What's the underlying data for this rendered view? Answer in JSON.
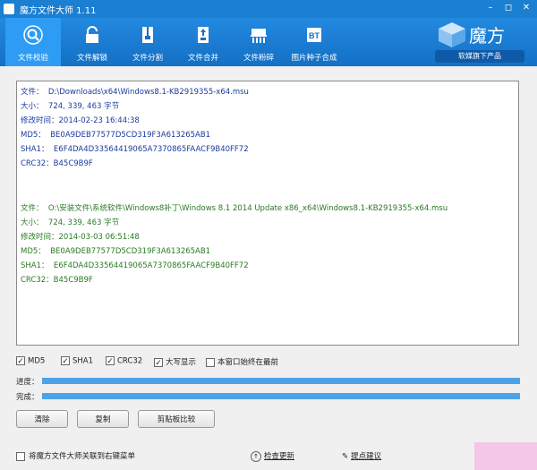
{
  "window": {
    "title": "魔方文件大师 1.11"
  },
  "toolbar": {
    "tools": [
      {
        "label": "文件校验"
      },
      {
        "label": "文件解锁"
      },
      {
        "label": "文件分割"
      },
      {
        "label": "文件合并"
      },
      {
        "label": "文件粉碎"
      },
      {
        "label": "图片种子合成"
      }
    ],
    "bt_text": "BT",
    "brand": "魔方",
    "badge": "软媒旗下产品"
  },
  "output": {
    "entries": [
      {
        "file_label": "文件：",
        "file": "D:\\Downloads\\x64\\Windows8.1-KB2919355-x64.msu",
        "size_label": "大小：",
        "size": "724, 339, 463 字节",
        "mtime_label": "修改时间：",
        "mtime": "2014-02-23 16:44:38",
        "md5_label": "MD5：",
        "md5": "BE0A9DEB77577D5CD319F3A613265AB1",
        "sha1_label": "SHA1：",
        "sha1": "E6F4DA4D33564419065A7370865FAACF9B40FF72",
        "crc_label": "CRC32：",
        "crc": "B45C9B9F"
      },
      {
        "file_label": "文件：",
        "file": "O:\\安装文件\\系统软件\\Windows8补丁\\Windows 8.1 2014 Update x86_x64\\Windows8.1-KB2919355-x64.msu",
        "size_label": "大小：",
        "size": "724, 339, 463 字节",
        "mtime_label": "修改时间：",
        "mtime": "2014-03-03 06:51:48",
        "md5_label": "MD5：",
        "md5": "BE0A9DEB77577D5CD319F3A613265AB1",
        "sha1_label": "SHA1：",
        "sha1": "E6F4DA4D33564419065A7370865FAACF9B40FF72",
        "crc_label": "CRC32：",
        "crc": "B45C9B9F"
      }
    ]
  },
  "options": {
    "md5": {
      "label": "MD5",
      "checked": true
    },
    "sha1": {
      "label": "SHA1",
      "checked": true
    },
    "crc32": {
      "label": "CRC32",
      "checked": true
    },
    "upper": {
      "label": "大写显示",
      "checked": true
    },
    "ontop": {
      "label": "本窗口始终在最前",
      "checked": false
    }
  },
  "progress": {
    "label": "进度：",
    "value": 1.0
  },
  "complete": {
    "label": "完成：",
    "value": 1.0
  },
  "buttons": {
    "clear": "清除",
    "copy": "复制",
    "compare": "剪贴板比较"
  },
  "footer": {
    "associate_label": "将魔方文件大师关联到右键菜单",
    "update_label": "检查更新",
    "feedback_label": "提点建议"
  },
  "colors": {
    "accent": "#1b7fd2",
    "path_blue": "#1c3a9c",
    "match_green": "#2a7a22"
  }
}
